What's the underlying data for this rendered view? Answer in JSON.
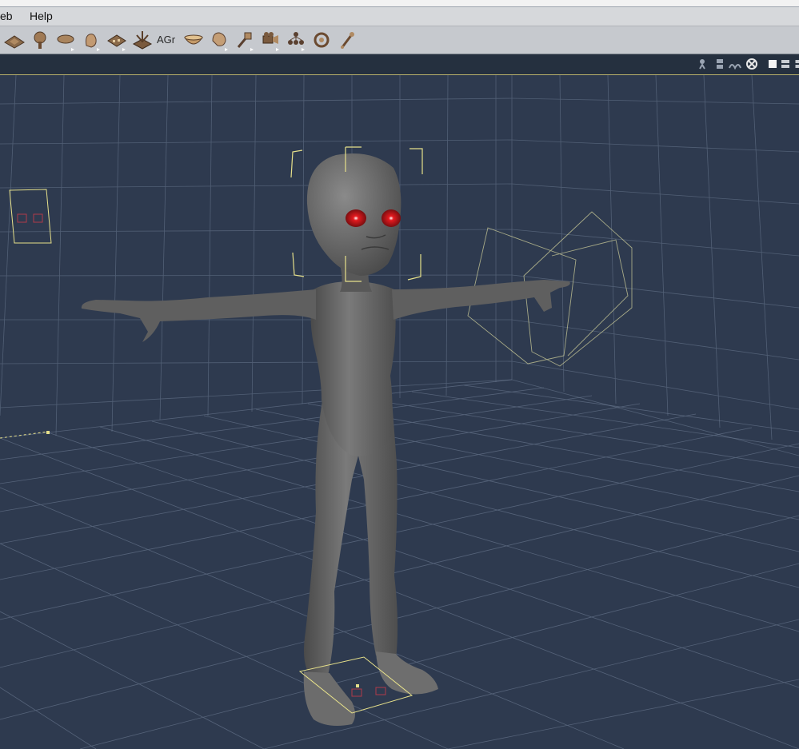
{
  "menu": {
    "items": [
      "Web",
      "Help"
    ],
    "first_visible": "eb",
    "second": "Help"
  },
  "toolbar": {
    "text_tool_label": "AGr",
    "tools": [
      "ground-tool",
      "tree-tool",
      "prop-tool",
      "hand-tool",
      "texture-tool",
      "sparkle-tool",
      "text-tool",
      "bowl-tool",
      "head-tool",
      "pin-tool",
      "camera-tool",
      "hierarchy-tool",
      "target-tool",
      "bone-tool"
    ]
  },
  "view_controls": {
    "icons": [
      "figure-select-icon",
      "camera-select-icon",
      "display-style-icon",
      "render-icon",
      "single-layout-icon",
      "split-layout-icon",
      "quad-layout-icon"
    ]
  },
  "scene": {
    "background_color": "#2e3a4f",
    "grid_color": "#6f7e95",
    "figure_color": "#6a6a6a",
    "eye_color": "#c0151a",
    "selection_color": "#e6e08a"
  }
}
